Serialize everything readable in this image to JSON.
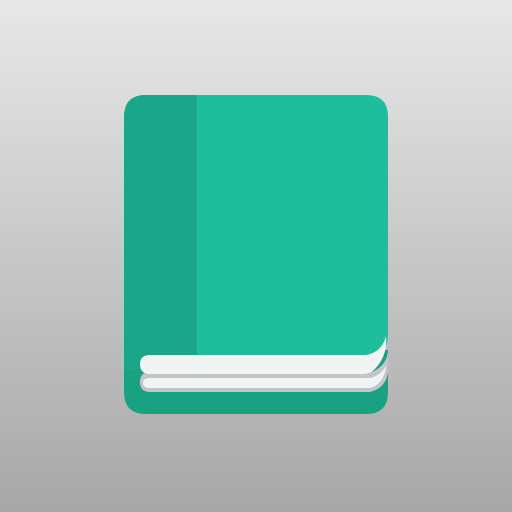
{
  "icon": {
    "name": "book-icon",
    "colors": {
      "cover": "#1ebd9b",
      "spine": "#1aa689",
      "back_cover": "#18a282",
      "pages_light": "#f2f3f3",
      "pages_shadow": "#c2c6cb",
      "background_top": "#e8e8e8",
      "background_bottom": "#a7a7a7"
    }
  }
}
